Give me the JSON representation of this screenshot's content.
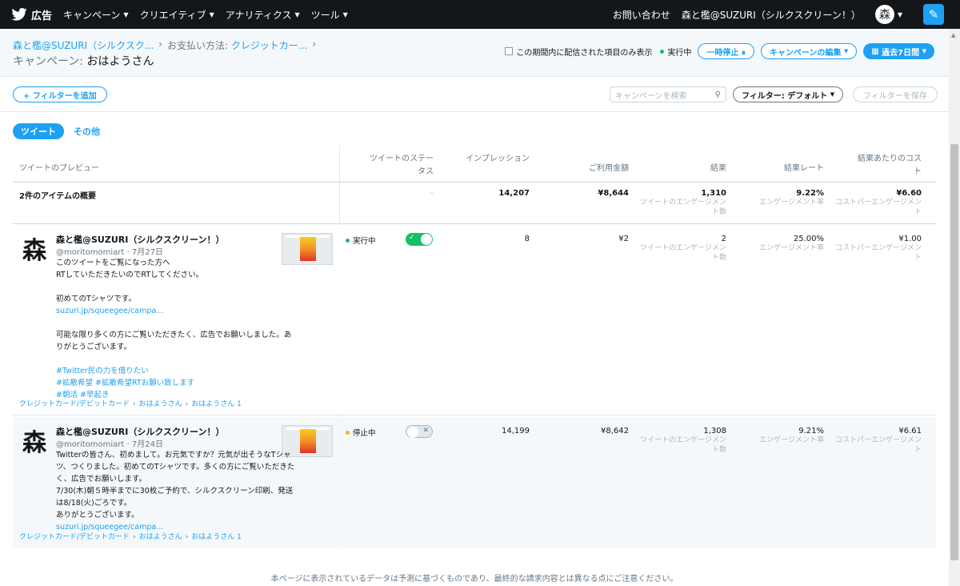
{
  "nav": {
    "brand": "広告",
    "items": [
      "キャンペーン",
      "クリエイティブ",
      "アナリティクス",
      "ツール"
    ],
    "contact": "お問い合わせ",
    "account": "森と檻@SUZURI（シルクスクリーン！）",
    "avatar_char": "森"
  },
  "header": {
    "crumbs": [
      "森と檻@SUZURI（シルクスク...",
      "お支払い方法:",
      "クレジットカー..."
    ],
    "title_prefix": "キャンペーン:",
    "title": "おはようさん",
    "only_period_label": "この期間内に配信された項目のみ表示",
    "running": "実行中",
    "pause_btn": "一時停止 ⏸",
    "edit_btn": "キャンペーンの編集",
    "range_btn": "過去7日間"
  },
  "filters": {
    "add": "+ フィルターを追加",
    "search_placeholder": "キャンペーンを検索",
    "default": "フィルター: デフォルト",
    "save": "フィルターを保存"
  },
  "tabs": [
    "ツイート",
    "その他"
  ],
  "columns": {
    "preview": "ツイートのプレビュー",
    "status": "ツイートのステータス",
    "impressions": "インプレッション",
    "spend": "ご利用金額",
    "results": "結果",
    "rate": "結果レート",
    "cost": "結果あたりのコスト"
  },
  "summary": {
    "label": "2件のアイテムの概要",
    "status": "–",
    "impressions": "14,207",
    "spend": "¥8,644",
    "results": "1,310",
    "results_sub": "ツイートのエンゲージメント数",
    "rate": "9.22%",
    "rate_sub": "エンゲージメント率",
    "cost": "¥6.60",
    "cost_sub": "コストパーエンゲージメント"
  },
  "rows": [
    {
      "name": "森と檻@SUZURI（シルクスクリーン！）",
      "handle": "@moritomomiart · 7月27日",
      "body1": "このツイートをご覧になった方へ\nRTしていただきたいのでRTしてください。",
      "body2": "初めてのTシャツです。",
      "link": "suzuri.jp/squeegee/campa...",
      "body3": "可能な限り多くの方にご覧いただきたく、広告でお願いしました。ありがとうございます。",
      "tags": "#Twitter民の力を借りたい\n#拡散希望 #拡散希望RTお願い致します\n#朝活 #早起き",
      "bc": [
        "クレジットカード/デビットカード",
        "おはようさん",
        "おはようさん 1"
      ],
      "status": "実行中",
      "status_color": "#17bf63",
      "impressions": "8",
      "spend": "¥2",
      "results": "2",
      "rate": "25.00%",
      "cost": "¥1.00"
    },
    {
      "name": "森と檻@SUZURI（シルクスクリーン！）",
      "handle": "@moritomomiart · 7月24日",
      "body1": "Twitterの皆さん、初めまして。お元気ですか？元気が出そうなTシャツ、つくりました。初めてのTシャツです。多くの方にご覧いただきたく、広告でお願いします。\n7/30(木)朝５時半までに30枚ご予約で、シルクスクリーン印刷、発送は8/18(火)ごろです。\nありがとうございます。",
      "link": "suzuri.jp/squeegee/campa...",
      "bc": [
        "クレジットカード/デビットカード",
        "おはようさん",
        "おはようさん 1"
      ],
      "status": "停止中",
      "status_color": "#ffad1f",
      "impressions": "14,199",
      "spend": "¥8,642",
      "results": "1,308",
      "rate": "9.21%",
      "cost": "¥6.61"
    }
  ],
  "metric_subs": {
    "results": "ツイートのエンゲージメント数",
    "rate": "エンゲージメント率",
    "cost": "コストパーエンゲージメント"
  },
  "footer": "本ページに表示されているデータは予測に基づくものであり、最終的な請求内容とは異なる点にご注意ください。",
  "colors": {
    "brand": "#1da1f2",
    "nav_bg": "#14171a",
    "running": "#17bf63",
    "paused": "#ffad1f"
  }
}
